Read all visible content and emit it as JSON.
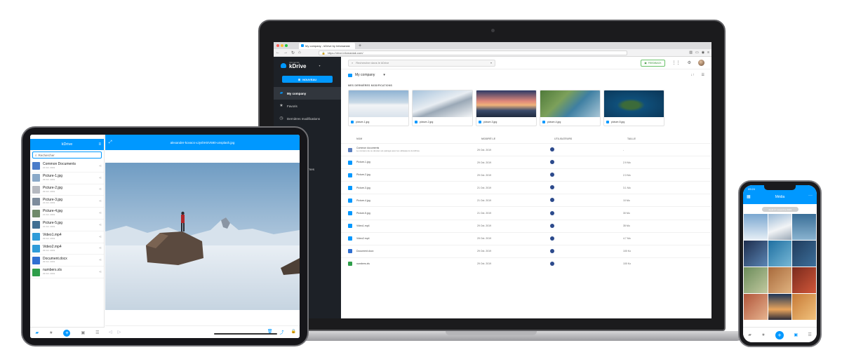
{
  "laptop": {
    "browser": {
      "tab_title": "My company - kDrive by Infomaniak",
      "tab_plus": "+",
      "url": "https://drive.infomaniak.com/"
    },
    "sidebar": {
      "brand_small": "Infomaniak",
      "brand": "kDrive",
      "new_button": "NOUVEAU",
      "items": [
        {
          "label": "My company",
          "icon": "folder-icon"
        },
        {
          "label": "Favoris",
          "icon": "star-icon"
        },
        {
          "label": "Dernières modifications",
          "icon": "clock-icon"
        },
        {
          "label": "",
          "icon": ""
        },
        {
          "label": "",
          "icon": ""
        },
        {
          "label": "ations",
          "icon": ""
        },
        {
          "label": "rives externes",
          "icon": ""
        },
        {
          "label": "u de bord",
          "icon": ""
        }
      ]
    },
    "header": {
      "search_placeholder": "Rechercher dans le kDrive",
      "feedback": "FEEDBACK"
    },
    "breadcrumb": "My company",
    "recent_title": "MES DERNIÈRES MODIFICATIONS",
    "recent": [
      {
        "label": "picture-1.jpg"
      },
      {
        "label": "picture-2.jpg"
      },
      {
        "label": "picture-3.jpg"
      },
      {
        "label": "picture-4.jpg"
      },
      {
        "label": "picture-5.jpg"
      }
    ],
    "table": {
      "headers": {
        "name": "NOM",
        "modified": "MODIFIÉ LE",
        "users": "UTILISATEURS",
        "size": "TAILLE"
      },
      "rows": [
        {
          "name": "Common documents",
          "sub": "Le contenu de ce dossier est partagé avec les utilisateurs du kDrive",
          "date": "29 Oct. 2019",
          "size": "-",
          "color": "#5b7fbf"
        },
        {
          "name": "Picture-1.jpg",
          "sub": "",
          "date": "29 Oct. 2019",
          "size": "2.9 Mo",
          "color": "#0098ff"
        },
        {
          "name": "Picture-2.jpg",
          "sub": "",
          "date": "29 Oct. 2019",
          "size": "2.3 Mo",
          "color": "#0098ff"
        },
        {
          "name": "Picture-3.jpg",
          "sub": "",
          "date": "21 Oct. 2019",
          "size": "3.1 Mo",
          "color": "#0098ff"
        },
        {
          "name": "Picture-4.jpg",
          "sub": "",
          "date": "21 Oct. 2019",
          "size": "10 Mo",
          "color": "#0098ff"
        },
        {
          "name": "Picture-5.jpg",
          "sub": "",
          "date": "21 Oct. 2019",
          "size": "30 Mo",
          "color": "#0098ff"
        },
        {
          "name": "Video1.mp4",
          "sub": "",
          "date": "29 Oct. 2019",
          "size": "35 Mo",
          "color": "#0098ff"
        },
        {
          "name": "Video2.mp4",
          "sub": "",
          "date": "29 Oct. 2019",
          "size": "4.7 Mo",
          "color": "#0098ff"
        },
        {
          "name": "Document.docx",
          "sub": "",
          "date": "29 Oct. 2019",
          "size": "100 Ko",
          "color": "#2f6fd1"
        },
        {
          "name": "numbers.xls",
          "sub": "",
          "date": "29 Oct. 2019",
          "size": "100 Ko",
          "color": "#2e9e4a"
        }
      ]
    }
  },
  "tablet": {
    "app_title": "kDrive",
    "search_placeholder": "Rechercher",
    "viewer_title": "alexander-kovacs-xJyshHSV590-unsplash.jpg",
    "files": [
      {
        "name": "Common Documents",
        "meta": "21 Oct. 2019",
        "color": "#4a7cc9"
      },
      {
        "name": "Picture-1.jpg",
        "meta": "29 Oct. 2019",
        "color": "#8aa9c8"
      },
      {
        "name": "Picture-2.jpg",
        "meta": "29 Oct. 2019",
        "color": "#b6b9c0"
      },
      {
        "name": "Picture-3.jpg",
        "meta": "21 Oct. 2019",
        "color": "#7e8c9c"
      },
      {
        "name": "Picture-4.jpg",
        "meta": "21 Oct. 2019",
        "color": "#6f8a6a"
      },
      {
        "name": "Picture-5.jpg",
        "meta": "21 Oct. 2019",
        "color": "#3f6f93"
      },
      {
        "name": "Video1.mp4",
        "meta": "29 Oct. 2019",
        "color": "#2f9bd8"
      },
      {
        "name": "Video2.mp4",
        "meta": "29 Oct. 2019",
        "color": "#2f9bd8"
      },
      {
        "name": "Document.docx",
        "meta": "29 Oct. 2019",
        "color": "#2f6fd1"
      },
      {
        "name": "numbers.xls",
        "meta": "29 Oct. 2019",
        "color": "#2e9e4a"
      }
    ]
  },
  "phone": {
    "time": "09:24",
    "title": "Média",
    "date_chip": "Jeudi 17 novembre 2019"
  },
  "colors": {
    "accent": "#0098ff",
    "sidebar_bg": "#1d2127"
  }
}
